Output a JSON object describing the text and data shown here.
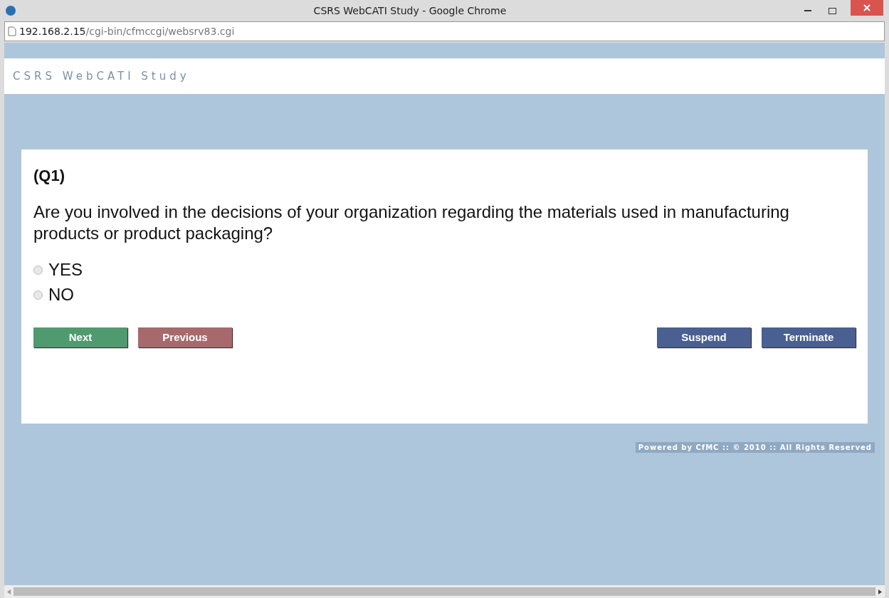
{
  "window": {
    "title": "CSRS WebCATI Study - Google Chrome"
  },
  "address_bar": {
    "host": "192.168.2.15",
    "path": "/cgi-bin/cfmccgi/websrv83.cgi"
  },
  "site_header": {
    "title": "CSRS WebCATI Study"
  },
  "question": {
    "number": "(Q1)",
    "text": "Are you involved in the decisions of your organization regarding the materials used in manufacturing products or product packaging?",
    "options": [
      {
        "label": "YES",
        "selected": false
      },
      {
        "label": "NO",
        "selected": false
      }
    ]
  },
  "buttons_left": [
    {
      "label": "Next",
      "color": "#4f9a6e"
    },
    {
      "label": "Previous",
      "color": "#a8696c"
    }
  ],
  "buttons_right": [
    {
      "label": "Suspend",
      "color": "#4a5f92"
    },
    {
      "label": "Terminate",
      "color": "#4a5f92"
    }
  ],
  "footer": {
    "text": "Powered by CfMC :: © 2010 :: All Rights Reserved"
  }
}
